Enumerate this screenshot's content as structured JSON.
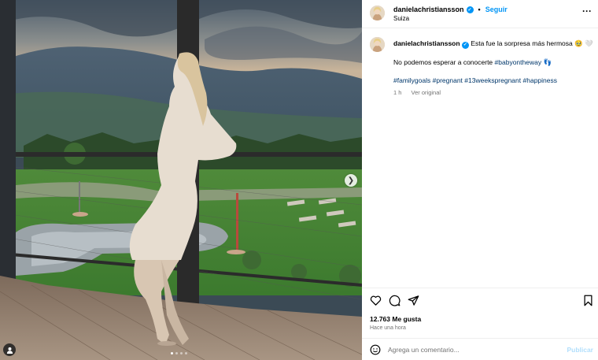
{
  "post": {
    "username": "danielachristiansson",
    "verified": true,
    "follow_label": "Seguir",
    "separator": "•",
    "location": "Suiza",
    "more_icon": "more-horizontal-icon"
  },
  "caption": {
    "username": "danielachristiansson",
    "line1_text": "Esta fue la sorpresa más hermosa 🥹 🤍",
    "line2_text": "No podemos esperar a conocerte ",
    "line2_hashtag": "#babyontheway",
    "line2_emoji": "👣",
    "hashtags": [
      "#familygoals",
      "#pregnant",
      "#13weekspregnant",
      "#happiness"
    ],
    "age": "1 h",
    "see_original": "Ver original"
  },
  "actions": {
    "like_icon": "heart-icon",
    "comment_icon": "comment-icon",
    "share_icon": "send-icon",
    "save_icon": "bookmark-icon",
    "likes": "12.763 Me gusta",
    "timestamp": "Hace una hora"
  },
  "comment": {
    "placeholder": "Agrega un comentario...",
    "post_label": "Publicar",
    "emoji_icon": "smile-icon"
  },
  "media": {
    "carousel_count": 4,
    "carousel_active": 1,
    "next_icon": "chevron-right-icon",
    "tag_icon": "user-tag-icon"
  },
  "colors": {
    "accent": "#0095f6",
    "hashtag": "#00376b",
    "muted": "#737373",
    "post_disabled": "#b2dffc"
  }
}
